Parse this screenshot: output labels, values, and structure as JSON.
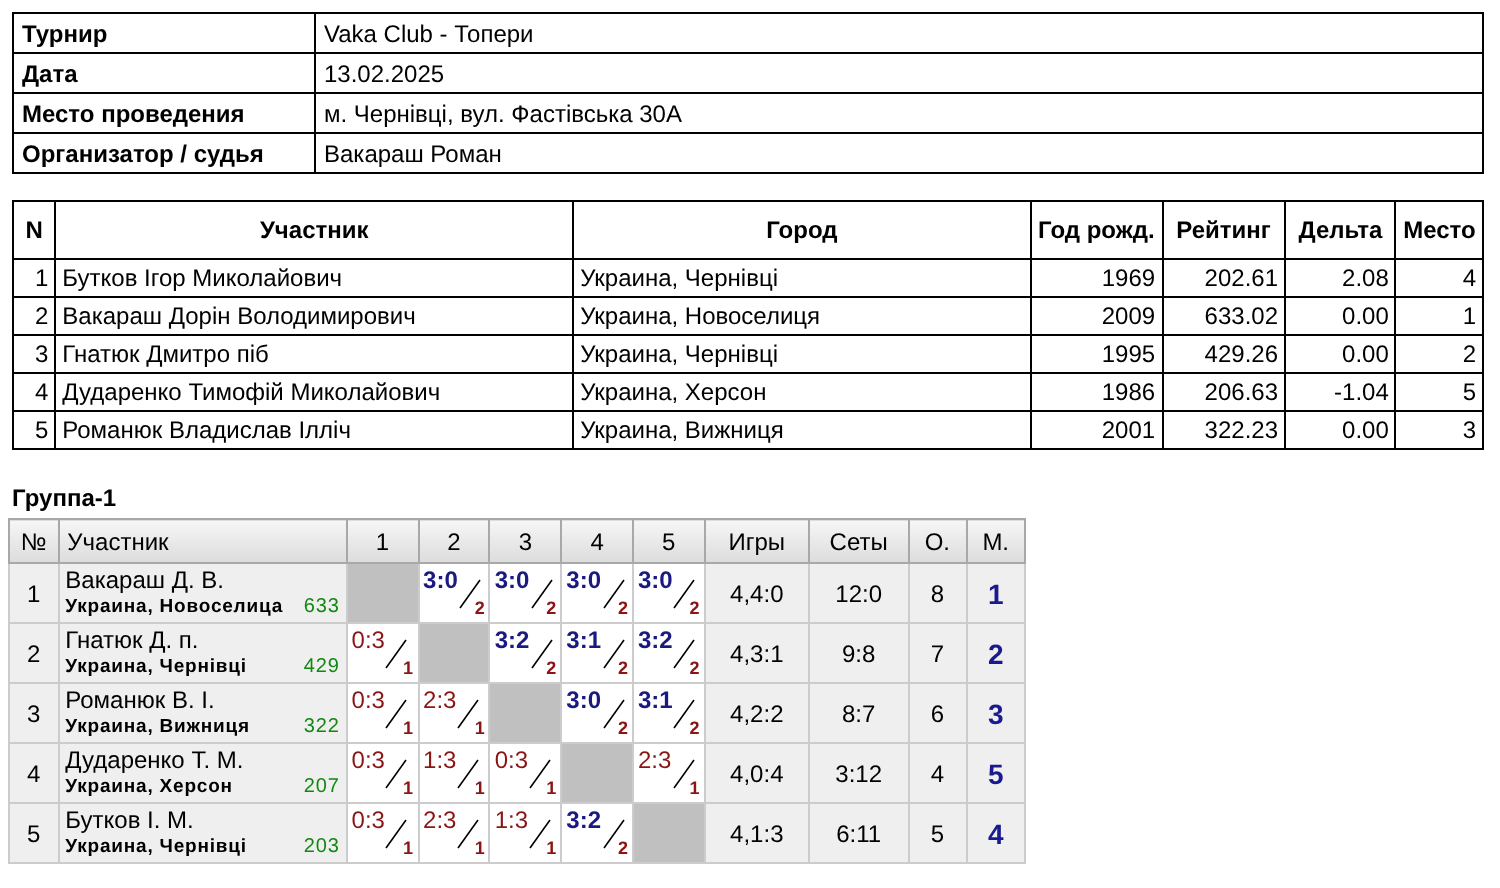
{
  "info": [
    {
      "label": "Турнир",
      "value": "Vaka Club - Топери"
    },
    {
      "label": "Дата",
      "value": "13.02.2025"
    },
    {
      "label": "Место проведения",
      "value": "м. Чернівці, вул. Фастівська 30А"
    },
    {
      "label": "Организатор / судья",
      "value": "Вакараш Роман"
    }
  ],
  "participants": {
    "columns": [
      "N",
      "Участник",
      "Город",
      "Год рожд.",
      "Рейтинг",
      "Дельта",
      "Место"
    ],
    "rows": [
      [
        "1",
        "Бутков Ігор Миколайович",
        "Украина, Чернівці",
        "1969",
        "202.61",
        "2.08",
        "4"
      ],
      [
        "2",
        "Вакараш Дорін Володимирович",
        "Украина, Новоселиця",
        "2009",
        "633.02",
        "0.00",
        "1"
      ],
      [
        "3",
        "Гнатюк Дмитро піб",
        "Украина, Чернівці",
        "1995",
        "429.26",
        "0.00",
        "2"
      ],
      [
        "4",
        "Дударенко Тимофій Миколайович",
        "Украина, Херсон",
        "1986",
        "206.63",
        "-1.04",
        "5"
      ],
      [
        "5",
        "Романюк Владислав Ілліч",
        "Украина, Вижниця",
        "2001",
        "322.23",
        "0.00",
        "3"
      ]
    ]
  },
  "group": {
    "title": "Группа-1",
    "columns": [
      "№",
      "Участник",
      "1",
      "2",
      "3",
      "4",
      "5",
      "Игры",
      "Сеты",
      "О.",
      "М."
    ],
    "rows": [
      {
        "n": "1",
        "name": "Вакараш Д. В.",
        "city": "Украина, Новоселица",
        "rating": "633",
        "results": [
          {
            "kind": "self"
          },
          {
            "kind": "game",
            "score": "3:0",
            "points": "2",
            "win": true
          },
          {
            "kind": "game",
            "score": "3:0",
            "points": "2",
            "win": true
          },
          {
            "kind": "game",
            "score": "3:0",
            "points": "2",
            "win": true
          },
          {
            "kind": "game",
            "score": "3:0",
            "points": "2",
            "win": true
          }
        ],
        "games": "4,4:0",
        "sets": "12:0",
        "points": "8",
        "place": "1"
      },
      {
        "n": "2",
        "name": "Гнатюк Д. п.",
        "city": "Украина, Чернівці",
        "rating": "429",
        "results": [
          {
            "kind": "game",
            "score": "0:3",
            "points": "1",
            "win": false
          },
          {
            "kind": "self"
          },
          {
            "kind": "game",
            "score": "3:2",
            "points": "2",
            "win": true
          },
          {
            "kind": "game",
            "score": "3:1",
            "points": "2",
            "win": true
          },
          {
            "kind": "game",
            "score": "3:2",
            "points": "2",
            "win": true
          }
        ],
        "games": "4,3:1",
        "sets": "9:8",
        "points": "7",
        "place": "2"
      },
      {
        "n": "3",
        "name": "Романюк В. І.",
        "city": "Украина, Вижниця",
        "rating": "322",
        "results": [
          {
            "kind": "game",
            "score": "0:3",
            "points": "1",
            "win": false
          },
          {
            "kind": "game",
            "score": "2:3",
            "points": "1",
            "win": false
          },
          {
            "kind": "self"
          },
          {
            "kind": "game",
            "score": "3:0",
            "points": "2",
            "win": true
          },
          {
            "kind": "game",
            "score": "3:1",
            "points": "2",
            "win": true
          }
        ],
        "games": "4,2:2",
        "sets": "8:7",
        "points": "6",
        "place": "3"
      },
      {
        "n": "4",
        "name": "Дударенко Т. М.",
        "city": "Украина, Херсон",
        "rating": "207",
        "results": [
          {
            "kind": "game",
            "score": "0:3",
            "points": "1",
            "win": false
          },
          {
            "kind": "game",
            "score": "1:3",
            "points": "1",
            "win": false
          },
          {
            "kind": "game",
            "score": "0:3",
            "points": "1",
            "win": false
          },
          {
            "kind": "self"
          },
          {
            "kind": "game",
            "score": "2:3",
            "points": "1",
            "win": false
          }
        ],
        "games": "4,0:4",
        "sets": "3:12",
        "points": "4",
        "place": "5"
      },
      {
        "n": "5",
        "name": "Бутков І. М.",
        "city": "Украина, Чернівці",
        "rating": "203",
        "results": [
          {
            "kind": "game",
            "score": "0:3",
            "points": "1",
            "win": false
          },
          {
            "kind": "game",
            "score": "2:3",
            "points": "1",
            "win": false
          },
          {
            "kind": "game",
            "score": "1:3",
            "points": "1",
            "win": false
          },
          {
            "kind": "game",
            "score": "3:2",
            "points": "2",
            "win": true
          },
          {
            "kind": "self"
          }
        ],
        "games": "4,1:3",
        "sets": "6:11",
        "points": "5",
        "place": "4"
      }
    ]
  }
}
